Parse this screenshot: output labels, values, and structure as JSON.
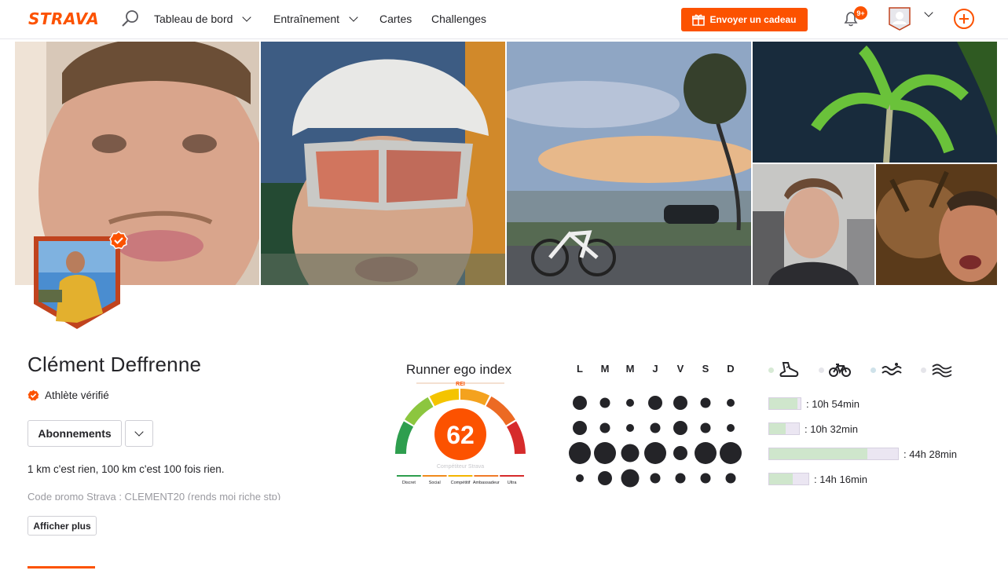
{
  "nav": {
    "logo": "STRAVA",
    "items": [
      {
        "label": "Tableau de bord",
        "has_dropdown": true
      },
      {
        "label": "Entraînement",
        "has_dropdown": true
      },
      {
        "label": "Cartes",
        "has_dropdown": false
      },
      {
        "label": "Challenges",
        "has_dropdown": false
      }
    ],
    "gift_button": "Envoyer un cadeau",
    "notifications_badge": "9+",
    "icons": [
      "search-icon",
      "gift-icon",
      "bell-icon",
      "avatar-icon",
      "plus-circle-icon"
    ]
  },
  "profile": {
    "name": "Clément Deffrenne",
    "verified_label": "Athlète vérifié",
    "subscriptions_button": "Abonnements",
    "bio": "1 km c'est rien, 100 km c'est 100 fois rien.",
    "promo": "Code promo Strava : CLEMENT20 (rends moi riche stp)",
    "show_more": "Afficher plus"
  },
  "ego_index": {
    "title": "Runner ego index",
    "abbr": "REI",
    "value": "62",
    "subtitle": "Compétiteur Strava",
    "scale": [
      "Discret",
      "Social",
      "Compétitif",
      "Ambassadeur",
      "Ultra"
    ],
    "colors": [
      "#2e9e4e",
      "#f08a1c",
      "#f4b400",
      "#f07a28",
      "#d62b2b"
    ]
  },
  "week": {
    "days": [
      "L",
      "M",
      "M",
      "J",
      "V",
      "S",
      "D"
    ],
    "rows": [
      [
        3,
        2,
        1,
        3,
        3,
        2,
        1
      ],
      [
        3,
        2,
        1,
        2,
        3,
        2,
        1
      ],
      [
        5,
        5,
        4,
        5,
        3,
        5,
        5
      ],
      [
        1,
        3,
        4,
        2,
        2,
        2,
        2
      ]
    ]
  },
  "sports": [
    {
      "icon": "running-shoe-icon",
      "dot_color": "#d7ead5",
      "time": "10h 54min",
      "fill": 0.9
    },
    {
      "icon": "bike-icon",
      "dot_color": "#e5e5ea",
      "time": "10h 32min",
      "fill": 0.55
    },
    {
      "icon": "swim-icon",
      "dot_color": "#cfe2ea",
      "time": "44h 28min",
      "fill": 0.76
    },
    {
      "icon": "wind-icon",
      "dot_color": "#e5e5ea",
      "time": "14h 16min",
      "fill": 0.6
    }
  ]
}
